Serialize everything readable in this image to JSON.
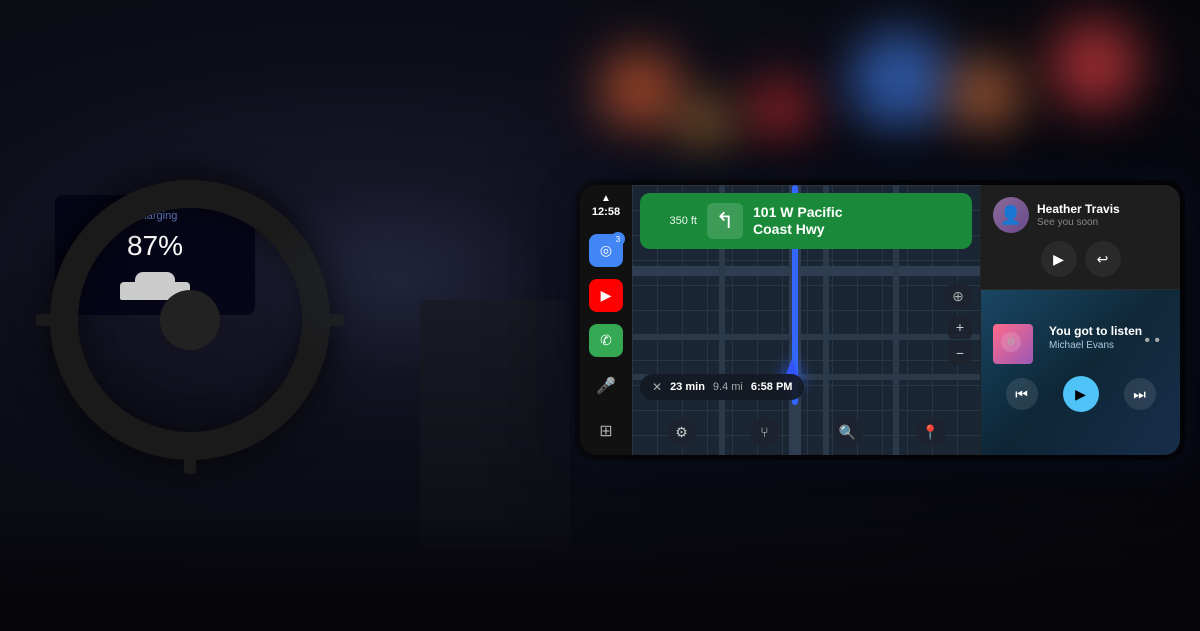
{
  "ui": {
    "background": {
      "description": "Car interior dashboard view at night"
    },
    "cluster": {
      "charging_label": "Charging",
      "battery_percent": "87%"
    },
    "infotainment": {
      "sidebar": {
        "time": "12:58",
        "signal": "▲",
        "icons": [
          {
            "name": "maps",
            "label": "Maps",
            "color": "#4285f4",
            "symbol": "◎"
          },
          {
            "name": "youtube",
            "label": "YouTube",
            "color": "#ff0000",
            "symbol": "▶"
          },
          {
            "name": "phone",
            "label": "Phone",
            "color": "#34a853",
            "symbol": "✆"
          },
          {
            "name": "mic",
            "label": "Microphone",
            "symbol": "🎤"
          },
          {
            "name": "grid",
            "label": "Apps",
            "symbol": "⊞"
          }
        ]
      },
      "navigation": {
        "distance": "350 ft",
        "street": "101 W Pacific\nCoast Hwy",
        "turn_direction": "left",
        "eta_minutes": "23 min",
        "eta_time": "6:58 PM",
        "eta_miles": "9.4 mi"
      },
      "call_card": {
        "caller_name": "Heather Travis",
        "caller_status": "See you soon",
        "actions": [
          {
            "name": "play",
            "symbol": "▶"
          },
          {
            "name": "reply",
            "symbol": "↩"
          }
        ]
      },
      "music_card": {
        "song_title": "You got to listen",
        "artist": "Michael Evans",
        "controls": [
          {
            "name": "previous",
            "symbol": "⏮"
          },
          {
            "name": "play",
            "symbol": "▶"
          },
          {
            "name": "next",
            "symbol": "⏭"
          }
        ]
      }
    }
  }
}
